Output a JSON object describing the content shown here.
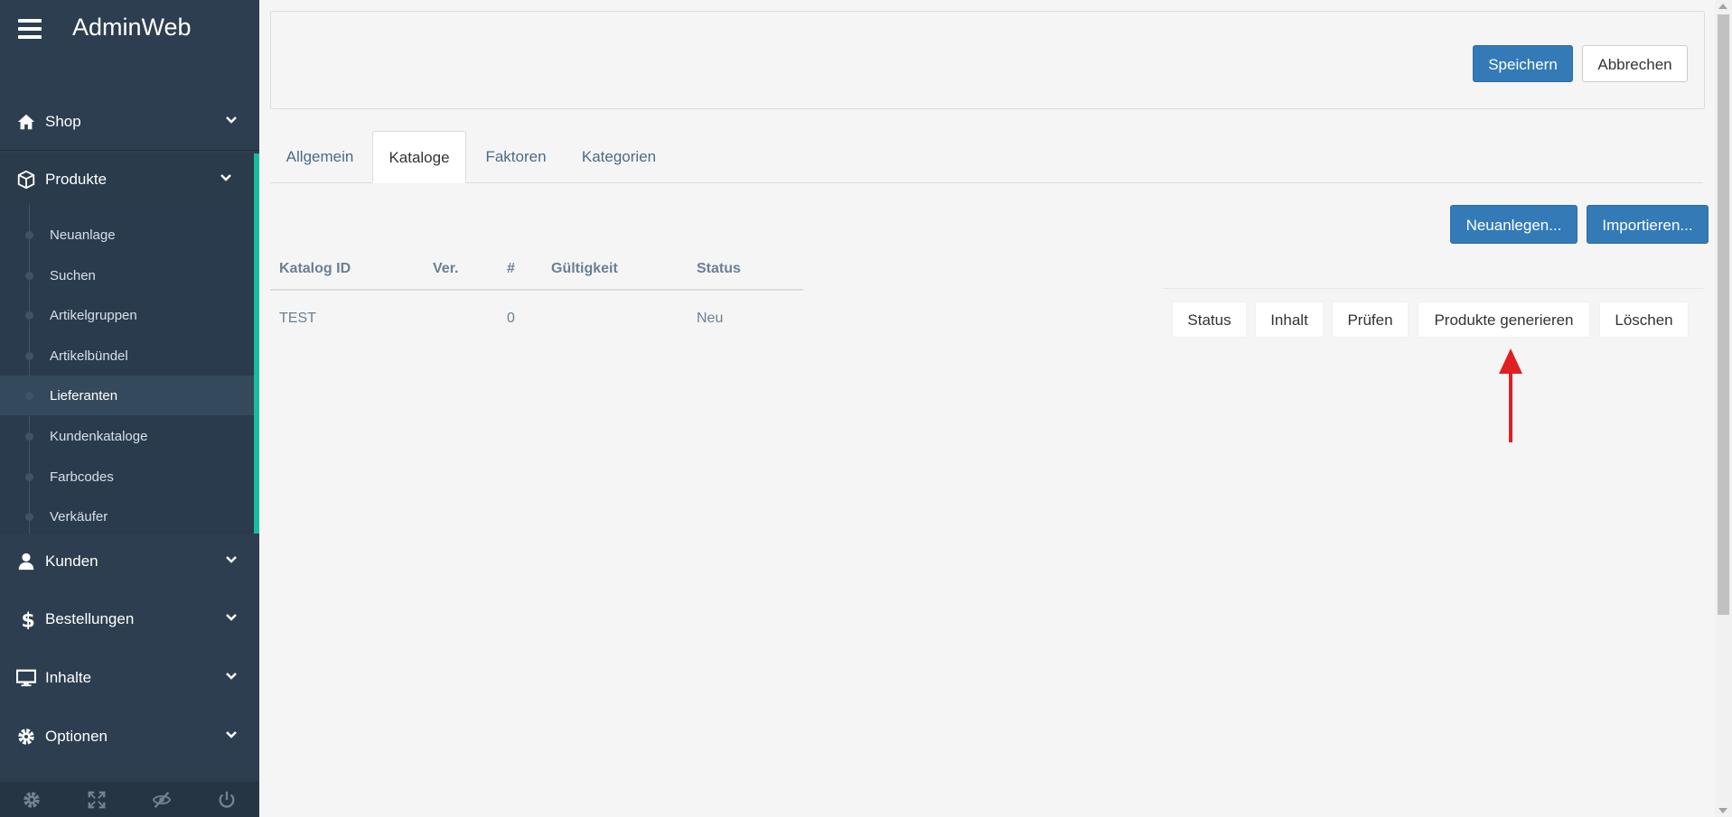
{
  "app": {
    "title": "AdminWeb"
  },
  "sidebar": {
    "menu": {
      "shop": "Shop",
      "produkte": "Produkte",
      "kunden": "Kunden",
      "bestellungen": "Bestellungen",
      "inhalte": "Inhalte",
      "optionen": "Optionen"
    },
    "submenu": [
      "Neuanlage",
      "Suchen",
      "Artikelgruppen",
      "Artikelbündel",
      "Lieferanten",
      "Kundenkataloge",
      "Farbcodes",
      "Verkäufer"
    ],
    "active_submenu": "Lieferanten",
    "accent_color": "#1abc9c"
  },
  "toolbar": {
    "save": "Speichern",
    "cancel": "Abbrechen"
  },
  "tabs": [
    "Allgemein",
    "Kataloge",
    "Faktoren",
    "Kategorien"
  ],
  "active_tab": "Kataloge",
  "catalog": {
    "new": "Neuanlegen...",
    "import": "Importieren...",
    "columns": [
      "Katalog ID",
      "Ver.",
      "#",
      "Gültigkeit",
      "Status"
    ],
    "rows": [
      {
        "id": "TEST",
        "ver": "",
        "count": "0",
        "validity": "",
        "status": "Neu"
      }
    ],
    "actions": [
      "Status",
      "Inhalt",
      "Prüfen",
      "Produkte generieren",
      "Löschen"
    ]
  },
  "annotation": {
    "arrow_color": "#e02020",
    "target": "Produkte generieren"
  }
}
